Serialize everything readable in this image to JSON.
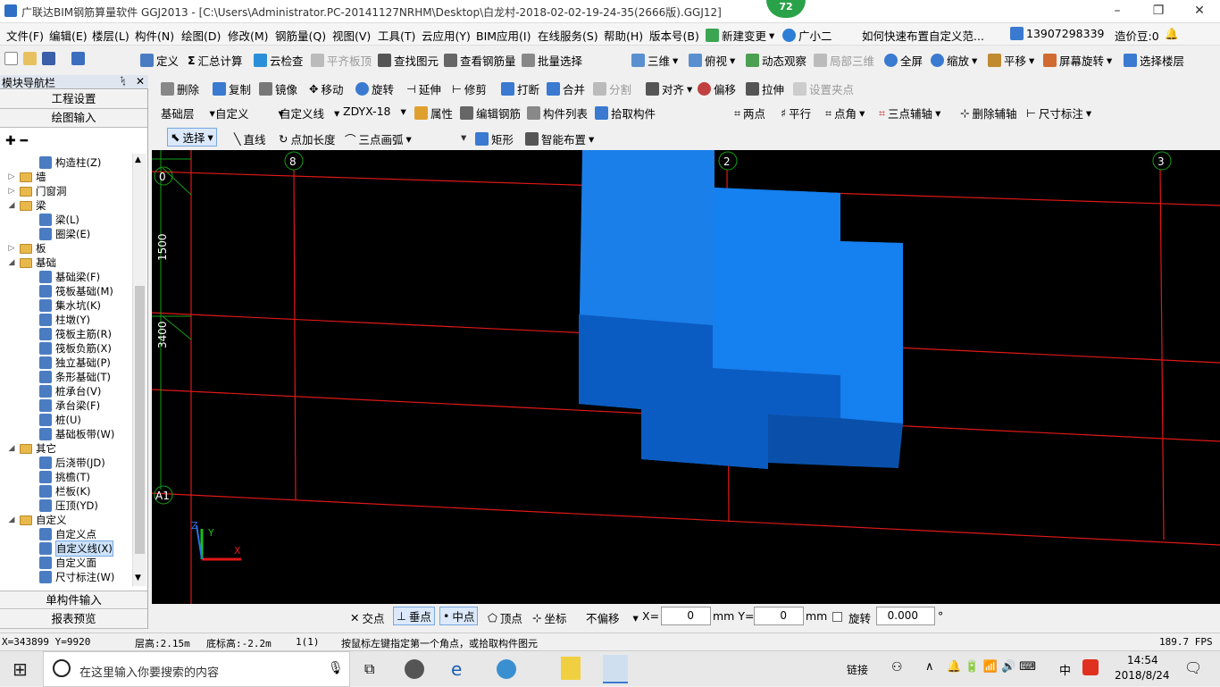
{
  "title": {
    "text": "广联达BIM钢筋算量软件 GGJ2013 - [C:\\Users\\Administrator.PC-20141127NRHM\\Desktop\\白龙村-2018-02-02-19-24-35(2666版).GGJ12]",
    "badge": "72",
    "min": "–",
    "max": "❐",
    "close": "✕"
  },
  "menu": [
    "文件(F)",
    "编辑(E)",
    "楼层(L)",
    "构件(N)",
    "绘图(D)",
    "修改(M)",
    "钢筋量(Q)",
    "视图(V)",
    "工具(T)",
    "云应用(Y)",
    "BIM应用(I)",
    "在线服务(S)",
    "帮助(H)",
    "版本号(B)",
    "新建变更",
    "广小二",
    "如何快速布置自定义范...",
    "13907298339",
    "造价豆:0"
  ],
  "toolbar1": [
    "定义",
    "汇总计算",
    "云检查",
    "平齐板顶",
    "查找图元",
    "查看钢筋量",
    "批量选择",
    "三维",
    "俯视",
    "动态观察",
    "局部三维",
    "全屏",
    "缩放",
    "平移",
    "屏幕旋转",
    "选择楼层"
  ],
  "toolbar2": [
    "删除",
    "复制",
    "镜像",
    "移动",
    "旋转",
    "延伸",
    "修剪",
    "打断",
    "合并",
    "分割",
    "对齐",
    "偏移",
    "拉伸",
    "设置夹点"
  ],
  "toolbar3": {
    "floor": "基础层",
    "type": "自定义",
    "line": "自定义线",
    "comp": "ZDYX-18",
    "items": [
      "属性",
      "编辑钢筋",
      "构件列表",
      "拾取构件"
    ],
    "right": [
      "两点",
      "平行",
      "点角",
      "三点辅轴",
      "删除辅轴",
      "尺寸标注"
    ]
  },
  "toolbar4": [
    "选择",
    "直线",
    "点加长度",
    "三点画弧",
    "矩形",
    "智能布置"
  ],
  "nav": {
    "header": "模块导航栏",
    "pin": "ᛪ",
    "close": "✕",
    "project_settings": "工程设置",
    "drawing_input": "绘图输入",
    "single_input": "单构件输入",
    "report_preview": "报表预览"
  },
  "tree": [
    {
      "label": "构造柱(Z)",
      "level": 2,
      "type": "item"
    },
    {
      "label": "墙",
      "level": 1,
      "type": "folder",
      "exp": "▷"
    },
    {
      "label": "门窗洞",
      "level": 1,
      "type": "folder",
      "exp": "▷"
    },
    {
      "label": "梁",
      "level": 1,
      "type": "folder",
      "exp": "◢"
    },
    {
      "label": "梁(L)",
      "level": 2,
      "type": "item"
    },
    {
      "label": "圈梁(E)",
      "level": 2,
      "type": "item"
    },
    {
      "label": "板",
      "level": 1,
      "type": "folder",
      "exp": "▷"
    },
    {
      "label": "基础",
      "level": 1,
      "type": "folder",
      "exp": "◢"
    },
    {
      "label": "基础梁(F)",
      "level": 2,
      "type": "item"
    },
    {
      "label": "筏板基础(M)",
      "level": 2,
      "type": "item"
    },
    {
      "label": "集水坑(K)",
      "level": 2,
      "type": "item"
    },
    {
      "label": "柱墩(Y)",
      "level": 2,
      "type": "item"
    },
    {
      "label": "筏板主筋(R)",
      "level": 2,
      "type": "item"
    },
    {
      "label": "筏板负筋(X)",
      "level": 2,
      "type": "item"
    },
    {
      "label": "独立基础(P)",
      "level": 2,
      "type": "item"
    },
    {
      "label": "条形基础(T)",
      "level": 2,
      "type": "item"
    },
    {
      "label": "桩承台(V)",
      "level": 2,
      "type": "item"
    },
    {
      "label": "承台梁(F)",
      "level": 2,
      "type": "item"
    },
    {
      "label": "桩(U)",
      "level": 2,
      "type": "item"
    },
    {
      "label": "基础板带(W)",
      "level": 2,
      "type": "item"
    },
    {
      "label": "其它",
      "level": 1,
      "type": "folder",
      "exp": "◢"
    },
    {
      "label": "后浇带(JD)",
      "level": 2,
      "type": "item"
    },
    {
      "label": "挑檐(T)",
      "level": 2,
      "type": "item"
    },
    {
      "label": "栏板(K)",
      "level": 2,
      "type": "item"
    },
    {
      "label": "压顶(YD)",
      "level": 2,
      "type": "item"
    },
    {
      "label": "自定义",
      "level": 1,
      "type": "folder",
      "exp": "◢"
    },
    {
      "label": "自定义点",
      "level": 2,
      "type": "item"
    },
    {
      "label": "自定义线(X)",
      "level": 2,
      "type": "item",
      "selected": true
    },
    {
      "label": "自定义面",
      "level": 2,
      "type": "item"
    },
    {
      "label": "尺寸标注(W)",
      "level": 2,
      "type": "item"
    }
  ],
  "canvas": {
    "axis_top": [
      "8",
      "2",
      "3"
    ],
    "axis_left": [
      "0",
      "A1"
    ],
    "dim_1500": "1500",
    "dim_3400": "3400",
    "coord_x": "X",
    "coord_y": "Y",
    "coord_z": "Z"
  },
  "snap": {
    "items": [
      "交点",
      "垂点",
      "中点",
      "顶点",
      "坐标"
    ],
    "offset": "不偏移",
    "x_label": "X=",
    "x_value": "0",
    "y_label": "mm Y=",
    "y_value": "0",
    "mm": "mm",
    "rotate_label": "旋转",
    "rotate_value": "0.000",
    "deg": "°"
  },
  "status": {
    "coords": "X=343899 Y=9920",
    "floor_h": "层高:2.15m",
    "base_h": "底标高:-2.2m",
    "count": "1(1)",
    "hint": "按鼠标左键指定第一个角点，或拾取构件图元",
    "fps": "189.7 FPS"
  },
  "taskbar": {
    "search": "在这里输入你要搜索的内容",
    "link": "链接",
    "lang": "中",
    "time": "14:54",
    "date": "2018/8/24"
  },
  "colors": {
    "canvas_bg": "#000000",
    "grid_red": "#e01818",
    "element_blue": "#1a7fe8"
  }
}
